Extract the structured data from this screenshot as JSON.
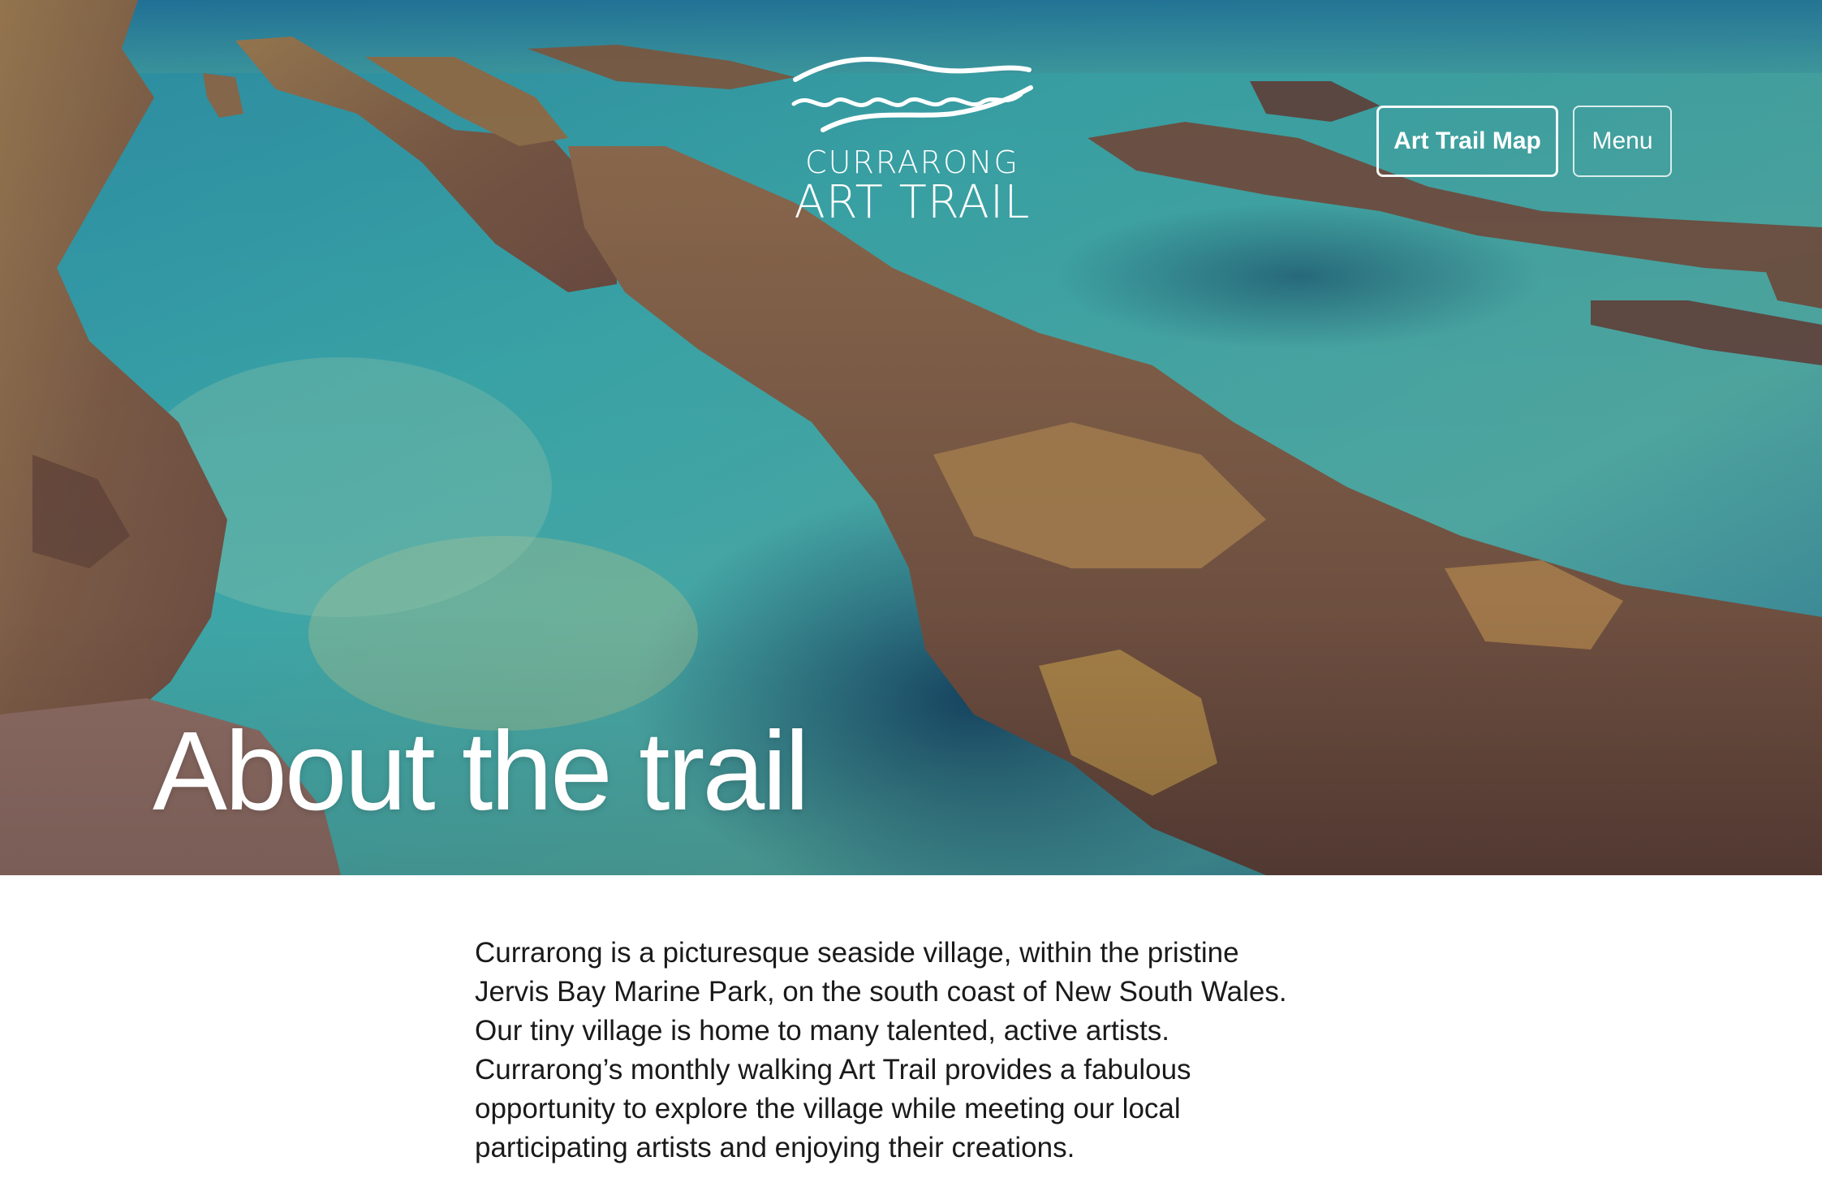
{
  "header": {
    "logo": {
      "line1": "CURRARONG",
      "line2": "ART TRAIL"
    },
    "nav": {
      "map_label": "Art Trail Map",
      "menu_label": "Menu"
    }
  },
  "hero": {
    "title": "About the trail"
  },
  "about": {
    "lines": [
      "Currarong is a picturesque seaside village, within the pristine",
      "Jervis Bay Marine Park, on the south coast of New South Wales.",
      "Our tiny village is home to many talented, active artists.",
      "Currarong’s monthly walking Art Trail provides a fabulous",
      "opportunity to explore the village while meeting our local",
      "participating artists and enjoying their creations."
    ]
  },
  "colors": {
    "text_on_hero": "#ffffff",
    "body_text": "#1a1a1a",
    "page_background": "#ffffff"
  }
}
